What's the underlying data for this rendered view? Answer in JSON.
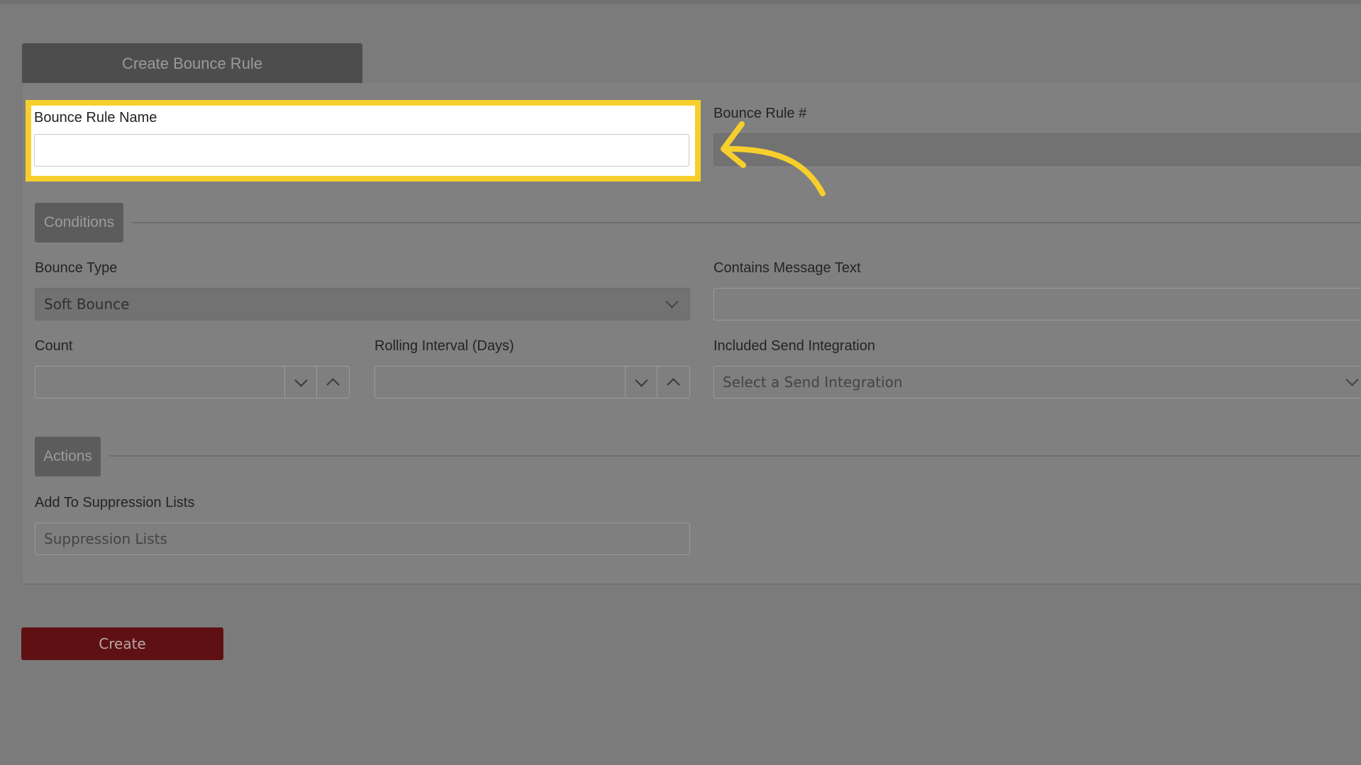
{
  "tab": {
    "title": "Create Bounce Rule"
  },
  "fields": {
    "bounce_rule_name": {
      "label": "Bounce Rule Name",
      "value": ""
    },
    "bounce_rule_number": {
      "label": "Bounce Rule #",
      "value": ""
    }
  },
  "sections": {
    "conditions": "Conditions",
    "actions": "Actions"
  },
  "conditions": {
    "bounce_type": {
      "label": "Bounce Type",
      "value": "Soft Bounce"
    },
    "contains_message_text": {
      "label": "Contains Message Text",
      "value": ""
    },
    "count": {
      "label": "Count",
      "value": ""
    },
    "rolling_interval": {
      "label": "Rolling Interval (Days)",
      "value": ""
    },
    "send_integration": {
      "label": "Included Send Integration",
      "placeholder": "Select a Send Integration"
    }
  },
  "actions": {
    "suppression": {
      "label": "Add To Suppression Lists",
      "placeholder": "Suppression Lists"
    }
  },
  "buttons": {
    "create": "Create"
  },
  "colors": {
    "highlight": "#f7cf2d",
    "create_button": "#5e1013"
  },
  "icons": {
    "callout": "curved-arrow-icon"
  }
}
